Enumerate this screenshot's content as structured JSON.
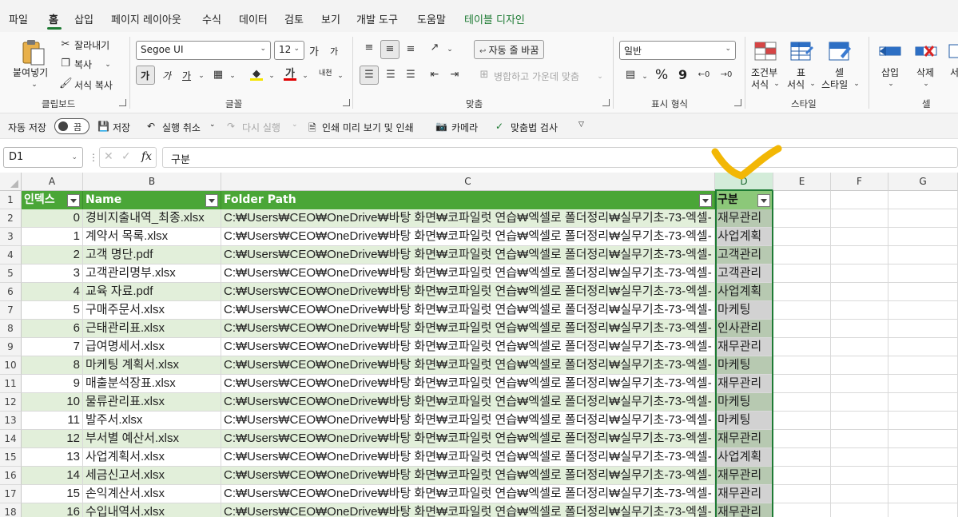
{
  "menu": {
    "tabs": [
      "파일",
      "홈",
      "삽입",
      "페이지 레이아웃",
      "수식",
      "데이터",
      "검토",
      "보기",
      "개발 도구",
      "도움말",
      "테이블 디자인"
    ],
    "active_index": 1
  },
  "ribbon": {
    "clipboard": {
      "label": "클립보드",
      "paste": "붙여넣기",
      "cut": "잘라내기",
      "copy": "복사",
      "format_painter": "서식 복사"
    },
    "font": {
      "label": "글꼴",
      "font_name": "Segoe UI",
      "font_size": "12",
      "bold": "가",
      "italic": "가",
      "underline": "가",
      "grow": "가",
      "shrink": "가",
      "phonetic": "내천"
    },
    "alignment": {
      "label": "맞춤",
      "wrap_text": "자동 줄 바꿈",
      "merge_center": "병합하고 가운데 맞춤"
    },
    "number": {
      "label": "표시 형식",
      "format": "일반",
      "percent": "%",
      "comma": "9"
    },
    "styles": {
      "label": "스타일",
      "conditional": [
        "조건부",
        "서식"
      ],
      "table": [
        "표",
        "서식"
      ],
      "cell": [
        "셀",
        "스타일"
      ]
    },
    "cells": {
      "label": "셀",
      "insert": "삽입",
      "delete": "삭제",
      "format": "서"
    }
  },
  "qat": {
    "autosave": "자동 저장",
    "toggle": "끔",
    "save": "저장",
    "undo": "실행 취소",
    "redo": "다시 실행",
    "print_preview": "인쇄 미리 보기 및 인쇄",
    "camera": "카메라",
    "spelling": "맞춤법 검사"
  },
  "formula_bar": {
    "name_box": "D1",
    "fx": "fx",
    "formula": "구분"
  },
  "grid": {
    "column_headers": [
      "A",
      "B",
      "C",
      "D",
      "E",
      "F",
      "G"
    ],
    "row_numbers": [
      "1",
      "2",
      "3",
      "4",
      "5",
      "6",
      "7",
      "8",
      "9",
      "10",
      "11",
      "12",
      "13",
      "14",
      "15",
      "16",
      "17",
      "18"
    ],
    "table_headers": [
      "인덱스",
      "Name",
      "Folder Path",
      "구분"
    ],
    "rows": [
      {
        "index": "0",
        "name": "경비지출내역_최종.xlsx",
        "path": "C:₩Users₩CEO₩OneDrive₩바탕 화면₩코파일럿 연습₩엑셀로 폴더정리₩실무기초-73-엑셀-",
        "category": "재무관리"
      },
      {
        "index": "1",
        "name": "계약서 목록.xlsx",
        "path": "C:₩Users₩CEO₩OneDrive₩바탕 화면₩코파일럿 연습₩엑셀로 폴더정리₩실무기초-73-엑셀-",
        "category": "사업계획"
      },
      {
        "index": "2",
        "name": "고객 명단.pdf",
        "path": "C:₩Users₩CEO₩OneDrive₩바탕 화면₩코파일럿 연습₩엑셀로 폴더정리₩실무기초-73-엑셀-",
        "category": "고객관리"
      },
      {
        "index": "3",
        "name": "고객관리명부.xlsx",
        "path": "C:₩Users₩CEO₩OneDrive₩바탕 화면₩코파일럿 연습₩엑셀로 폴더정리₩실무기초-73-엑셀-",
        "category": "고객관리"
      },
      {
        "index": "4",
        "name": "교육 자료.pdf",
        "path": "C:₩Users₩CEO₩OneDrive₩바탕 화면₩코파일럿 연습₩엑셀로 폴더정리₩실무기초-73-엑셀-",
        "category": "사업계획"
      },
      {
        "index": "5",
        "name": "구매주문서.xlsx",
        "path": "C:₩Users₩CEO₩OneDrive₩바탕 화면₩코파일럿 연습₩엑셀로 폴더정리₩실무기초-73-엑셀-",
        "category": "마케팅"
      },
      {
        "index": "6",
        "name": "근태관리표.xlsx",
        "path": "C:₩Users₩CEO₩OneDrive₩바탕 화면₩코파일럿 연습₩엑셀로 폴더정리₩실무기초-73-엑셀-",
        "category": "인사관리"
      },
      {
        "index": "7",
        "name": "급여명세서.xlsx",
        "path": "C:₩Users₩CEO₩OneDrive₩바탕 화면₩코파일럿 연습₩엑셀로 폴더정리₩실무기초-73-엑셀-",
        "category": "재무관리"
      },
      {
        "index": "8",
        "name": "마케팅 계획서.xlsx",
        "path": "C:₩Users₩CEO₩OneDrive₩바탕 화면₩코파일럿 연습₩엑셀로 폴더정리₩실무기초-73-엑셀-",
        "category": "마케팅"
      },
      {
        "index": "9",
        "name": "매출분석장표.xlsx",
        "path": "C:₩Users₩CEO₩OneDrive₩바탕 화면₩코파일럿 연습₩엑셀로 폴더정리₩실무기초-73-엑셀-",
        "category": "재무관리"
      },
      {
        "index": "10",
        "name": "물류관리표.xlsx",
        "path": "C:₩Users₩CEO₩OneDrive₩바탕 화면₩코파일럿 연습₩엑셀로 폴더정리₩실무기초-73-엑셀-",
        "category": "마케팅"
      },
      {
        "index": "11",
        "name": "발주서.xlsx",
        "path": "C:₩Users₩CEO₩OneDrive₩바탕 화면₩코파일럿 연습₩엑셀로 폴더정리₩실무기초-73-엑셀-",
        "category": "마케팅"
      },
      {
        "index": "12",
        "name": "부서별 예산서.xlsx",
        "path": "C:₩Users₩CEO₩OneDrive₩바탕 화면₩코파일럿 연습₩엑셀로 폴더정리₩실무기초-73-엑셀-",
        "category": "재무관리"
      },
      {
        "index": "13",
        "name": "사업계획서.xlsx",
        "path": "C:₩Users₩CEO₩OneDrive₩바탕 화면₩코파일럿 연습₩엑셀로 폴더정리₩실무기초-73-엑셀-",
        "category": "사업계획"
      },
      {
        "index": "14",
        "name": "세금신고서.xlsx",
        "path": "C:₩Users₩CEO₩OneDrive₩바탕 화면₩코파일럿 연습₩엑셀로 폴더정리₩실무기초-73-엑셀-",
        "category": "재무관리"
      },
      {
        "index": "15",
        "name": "손익계산서.xlsx",
        "path": "C:₩Users₩CEO₩OneDrive₩바탕 화면₩코파일럿 연습₩엑셀로 폴더정리₩실무기초-73-엑셀-",
        "category": "재무관리"
      },
      {
        "index": "16",
        "name": "수입내역서.xlsx",
        "path": "C:₩Users₩CEO₩OneDrive₩바탕 화면₩코파일럿 연습₩엑셀로 폴더정리₩실무기초-73-엑셀-",
        "category": "재무관리"
      }
    ]
  },
  "colors": {
    "accent": "#1e7b34",
    "table_header": "#4aa637",
    "band": "#e2efda",
    "annotation": "#f2b705"
  }
}
